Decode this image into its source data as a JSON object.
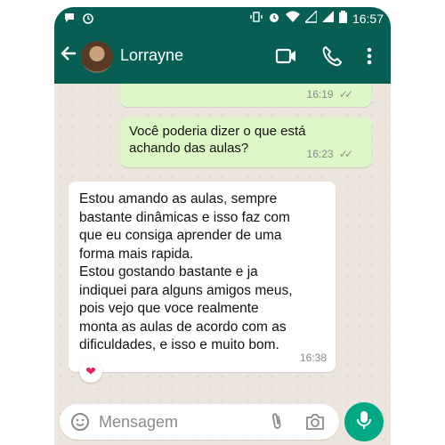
{
  "status_bar": {
    "time": "16:57",
    "left_icons": [
      "chat-bubble-icon",
      "alarm-icon"
    ],
    "right_icons": [
      "vibrate-icon",
      "alarm-icon",
      "wifi-icon",
      "signal-icon",
      "signal-icon",
      "battery-icon"
    ]
  },
  "header": {
    "back_icon": "arrow-left-icon",
    "contact_name": "Lorrayne",
    "actions": [
      "video-call-icon",
      "phone-call-icon",
      "more-vert-icon"
    ]
  },
  "messages": [
    {
      "direction": "out",
      "text": "",
      "time": "16:19",
      "read": true
    },
    {
      "direction": "out",
      "text": "Você poderia dizer o que está achando das aulas?",
      "time": "16:23",
      "read": true
    },
    {
      "direction": "in",
      "text_lines": [
        "Estou amando as aulas, sempre",
        "bastante dinâmicas e isso faz com",
        "que eu consiga aprender de uma",
        "forma mais rapida.",
        "Estou gostando bastante e ja",
        "indiquei para alguns amigos meus,",
        "pois vejo que voce realmente",
        "monta as aulas de acordo com as",
        "dificuldades, e isso e muito bom."
      ],
      "time": "16:38",
      "reaction": "❤"
    }
  ],
  "composer": {
    "placeholder": "Mensagem",
    "icons": [
      "emoji-icon",
      "attach-icon",
      "camera-icon"
    ],
    "mic_icon": "mic-icon"
  },
  "colors": {
    "header": "#075e54",
    "outgoing_bubble": "#dcf8c6",
    "incoming_bubble": "#ffffff",
    "chat_background": "#ece5dd",
    "mic_button": "#00a884"
  }
}
